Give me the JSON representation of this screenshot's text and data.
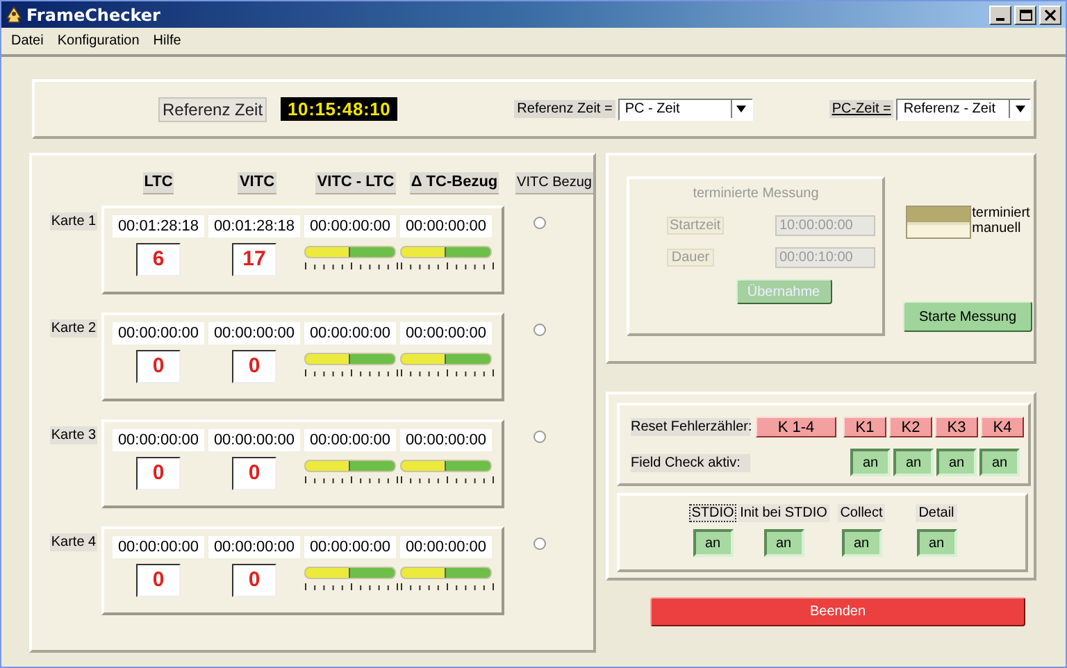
{
  "window": {
    "title": "FrameChecker"
  },
  "menu": [
    "Datei",
    "Konfiguration",
    "Hilfe"
  ],
  "reference_bar": {
    "label": "Referenz Zeit",
    "time": "10:15:48:10",
    "selectors": [
      {
        "label": "Referenz Zeit =",
        "value": "PC - Zeit"
      },
      {
        "label": "PC-Zeit =",
        "value": "Referenz - Zeit"
      }
    ]
  },
  "cards": {
    "columns": [
      "LTC",
      "VITC",
      "VITC - LTC",
      "Δ TC-Bezug",
      "VITC Bezug"
    ],
    "rows": [
      {
        "label": "Karte 1",
        "times": [
          "00:01:28:18",
          "00:01:28:18",
          "00:00:00:00",
          "00:00:00:00"
        ],
        "errors": [
          "6",
          "17"
        ],
        "meters": [
          {
            "level": 0.5
          },
          {
            "level": 0.5
          }
        ],
        "selected": false
      },
      {
        "label": "Karte 2",
        "times": [
          "00:00:00:00",
          "00:00:00:00",
          "00:00:00:00",
          "00:00:00:00"
        ],
        "errors": [
          "0",
          "0"
        ],
        "meters": [
          {
            "level": 0.5
          },
          {
            "level": 0.5
          }
        ],
        "selected": false
      },
      {
        "label": "Karte 3",
        "times": [
          "00:00:00:00",
          "00:00:00:00",
          "00:00:00:00",
          "00:00:00:00"
        ],
        "errors": [
          "0",
          "0"
        ],
        "meters": [
          {
            "level": 0.5
          },
          {
            "level": 0.5
          }
        ],
        "selected": false
      },
      {
        "label": "Karte 4",
        "times": [
          "00:00:00:00",
          "00:00:00:00",
          "00:00:00:00",
          "00:00:00:00"
        ],
        "errors": [
          "0",
          "0"
        ],
        "meters": [
          {
            "level": 0.5
          },
          {
            "level": 0.5
          }
        ],
        "selected": false
      }
    ]
  },
  "measurement": {
    "title": "terminierte Messung",
    "disabled": true,
    "fields": [
      {
        "label": "Startzeit",
        "value": "10:00:00:00"
      },
      {
        "label": "Dauer",
        "value": "00:00:10:00"
      }
    ],
    "button": "Übernahme"
  },
  "legend": [
    {
      "label": "terminiert",
      "color": "#b5aa6e"
    },
    {
      "label": "manuell",
      "color": "#f6f2dc"
    }
  ],
  "start_button": "Starte Messung",
  "reset": {
    "label": "Reset Fehlerzähler:",
    "buttons": [
      "K 1-4",
      "K1",
      "K2",
      "K3",
      "K4"
    ]
  },
  "field_check": {
    "label": "Field Check aktiv:",
    "toggles": [
      {
        "label": "an",
        "on": true
      },
      {
        "label": "an",
        "on": true
      },
      {
        "label": "an",
        "on": true
      },
      {
        "label": "an",
        "on": true
      }
    ]
  },
  "options": [
    {
      "label": "STDIO",
      "focused": true,
      "toggle": {
        "label": "an",
        "on": true
      }
    },
    {
      "label": "Init bei STDIO",
      "focused": false,
      "toggle": {
        "label": "an",
        "on": true
      }
    },
    {
      "label": "Collect",
      "focused": false,
      "toggle": {
        "label": "an",
        "on": true
      }
    },
    {
      "label": "Detail",
      "focused": false,
      "toggle": {
        "label": "an",
        "on": true
      }
    }
  ],
  "exit_button": "Beenden"
}
